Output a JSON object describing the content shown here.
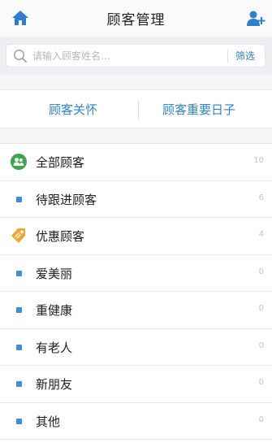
{
  "header": {
    "title": "顾客管理",
    "home_icon": "home-icon",
    "add_icon": "add-user-icon",
    "accent_color": "#2f7fd0"
  },
  "search": {
    "placeholder": "请输入顾客姓名...",
    "value": "",
    "filter_label": "筛选"
  },
  "tabs": [
    {
      "label": "顾客关怀"
    },
    {
      "label": "顾客重要日子"
    }
  ],
  "list": {
    "items": [
      {
        "label": "全部顾客",
        "count": "10",
        "icon": "customers-icon"
      },
      {
        "label": "待跟进顾客",
        "count": "6",
        "icon": "bullet"
      },
      {
        "label": "优惠顾客",
        "count": "4",
        "icon": "discount-tag-icon"
      },
      {
        "label": "爱美丽",
        "count": "0",
        "icon": "bullet"
      },
      {
        "label": "重健康",
        "count": "0",
        "icon": "bullet"
      },
      {
        "label": "有老人",
        "count": "0",
        "icon": "bullet"
      },
      {
        "label": "新朋友",
        "count": "0",
        "icon": "bullet"
      },
      {
        "label": "其他",
        "count": "0",
        "icon": "bullet"
      }
    ]
  }
}
